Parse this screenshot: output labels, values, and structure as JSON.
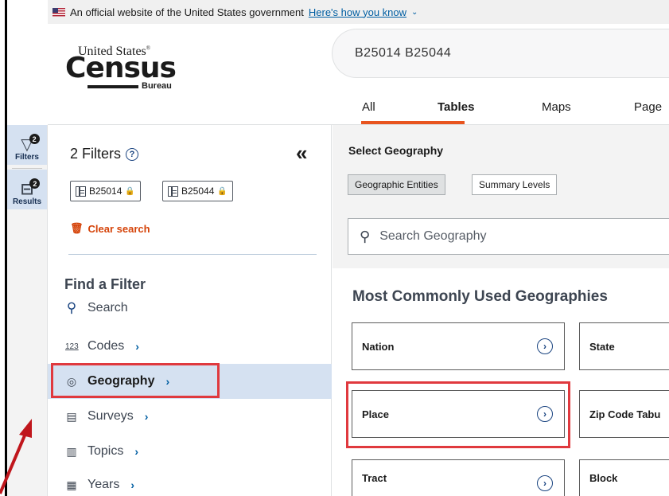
{
  "gov_banner": {
    "text": "An official website of the United States government",
    "link": "Here's how you know",
    "chevron": "⌄"
  },
  "logo": {
    "line1": "United States",
    "reg": "®",
    "line2": "Census",
    "line3": "Bureau"
  },
  "search": {
    "value": "B25014 B25044"
  },
  "tabs": [
    {
      "label": "All"
    },
    {
      "label": "Tables"
    },
    {
      "label": "Maps"
    },
    {
      "label": "Page"
    }
  ],
  "rail": {
    "filters_label": "Filters",
    "filters_badge": "2",
    "results_label": "Results",
    "results_badge": "2"
  },
  "panel": {
    "title": "2 Filters",
    "help": "?",
    "collapse": "«",
    "chips": [
      {
        "label": "B25014"
      },
      {
        "label": "B25044"
      }
    ],
    "clear": "Clear search",
    "find_title": "Find a Filter",
    "nav": [
      {
        "label": "Search",
        "icon": "search-icon"
      },
      {
        "label": "Codes",
        "icon": "codes-icon",
        "icon_text": "123"
      },
      {
        "label": "Geography",
        "icon": "map-pin-icon"
      },
      {
        "label": "Surveys",
        "icon": "clipboard-icon"
      },
      {
        "label": "Topics",
        "icon": "book-icon"
      },
      {
        "label": "Years",
        "icon": "calendar-icon"
      }
    ],
    "chevron": "›"
  },
  "geography": {
    "label": "Select Geography",
    "segments": [
      "Geographic Entities",
      "Summary Levels"
    ],
    "search_placeholder": "Search Geography",
    "common_title": "Most Commonly Used Geographies",
    "cards": [
      {
        "label": "Nation"
      },
      {
        "label": "State"
      },
      {
        "label": "Place"
      },
      {
        "label": "Zip Code Tabu"
      },
      {
        "label": "Tract"
      },
      {
        "label": "Block"
      }
    ],
    "card_arrow": "›"
  },
  "colors": {
    "accent": "#e8541e",
    "highlight": "#e0393e",
    "active_bg": "#d5e1f1",
    "link": "#005ea2",
    "clear": "#d54309"
  }
}
